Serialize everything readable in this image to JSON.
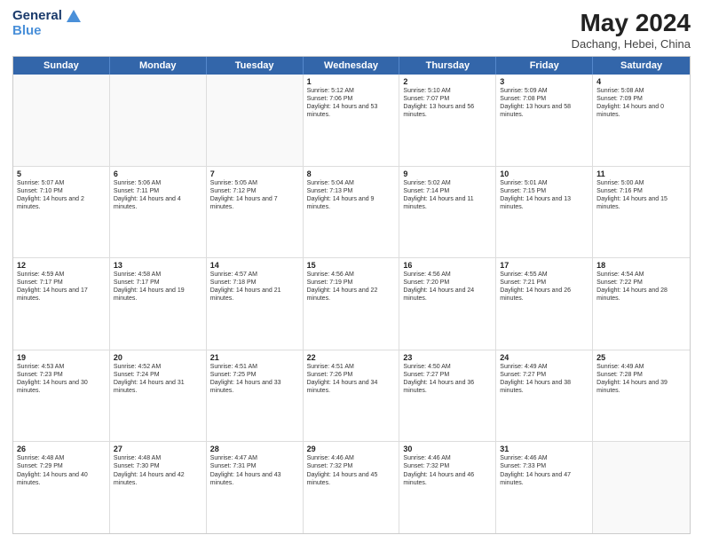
{
  "header": {
    "logo_line1": "General",
    "logo_line2": "Blue",
    "main_title": "May 2024",
    "subtitle": "Dachang, Hebei, China"
  },
  "weekdays": [
    "Sunday",
    "Monday",
    "Tuesday",
    "Wednesday",
    "Thursday",
    "Friday",
    "Saturday"
  ],
  "weeks": [
    [
      {
        "day": "",
        "sunrise": "",
        "sunset": "",
        "daylight": "",
        "empty": true
      },
      {
        "day": "",
        "sunrise": "",
        "sunset": "",
        "daylight": "",
        "empty": true
      },
      {
        "day": "",
        "sunrise": "",
        "sunset": "",
        "daylight": "",
        "empty": true
      },
      {
        "day": "1",
        "sunrise": "Sunrise: 5:12 AM",
        "sunset": "Sunset: 7:06 PM",
        "daylight": "Daylight: 14 hours and 53 minutes."
      },
      {
        "day": "2",
        "sunrise": "Sunrise: 5:10 AM",
        "sunset": "Sunset: 7:07 PM",
        "daylight": "Daylight: 13 hours and 56 minutes."
      },
      {
        "day": "3",
        "sunrise": "Sunrise: 5:09 AM",
        "sunset": "Sunset: 7:08 PM",
        "daylight": "Daylight: 13 hours and 58 minutes."
      },
      {
        "day": "4",
        "sunrise": "Sunrise: 5:08 AM",
        "sunset": "Sunset: 7:09 PM",
        "daylight": "Daylight: 14 hours and 0 minutes."
      }
    ],
    [
      {
        "day": "5",
        "sunrise": "Sunrise: 5:07 AM",
        "sunset": "Sunset: 7:10 PM",
        "daylight": "Daylight: 14 hours and 2 minutes."
      },
      {
        "day": "6",
        "sunrise": "Sunrise: 5:06 AM",
        "sunset": "Sunset: 7:11 PM",
        "daylight": "Daylight: 14 hours and 4 minutes."
      },
      {
        "day": "7",
        "sunrise": "Sunrise: 5:05 AM",
        "sunset": "Sunset: 7:12 PM",
        "daylight": "Daylight: 14 hours and 7 minutes."
      },
      {
        "day": "8",
        "sunrise": "Sunrise: 5:04 AM",
        "sunset": "Sunset: 7:13 PM",
        "daylight": "Daylight: 14 hours and 9 minutes."
      },
      {
        "day": "9",
        "sunrise": "Sunrise: 5:02 AM",
        "sunset": "Sunset: 7:14 PM",
        "daylight": "Daylight: 14 hours and 11 minutes."
      },
      {
        "day": "10",
        "sunrise": "Sunrise: 5:01 AM",
        "sunset": "Sunset: 7:15 PM",
        "daylight": "Daylight: 14 hours and 13 minutes."
      },
      {
        "day": "11",
        "sunrise": "Sunrise: 5:00 AM",
        "sunset": "Sunset: 7:16 PM",
        "daylight": "Daylight: 14 hours and 15 minutes."
      }
    ],
    [
      {
        "day": "12",
        "sunrise": "Sunrise: 4:59 AM",
        "sunset": "Sunset: 7:17 PM",
        "daylight": "Daylight: 14 hours and 17 minutes."
      },
      {
        "day": "13",
        "sunrise": "Sunrise: 4:58 AM",
        "sunset": "Sunset: 7:17 PM",
        "daylight": "Daylight: 14 hours and 19 minutes."
      },
      {
        "day": "14",
        "sunrise": "Sunrise: 4:57 AM",
        "sunset": "Sunset: 7:18 PM",
        "daylight": "Daylight: 14 hours and 21 minutes."
      },
      {
        "day": "15",
        "sunrise": "Sunrise: 4:56 AM",
        "sunset": "Sunset: 7:19 PM",
        "daylight": "Daylight: 14 hours and 22 minutes."
      },
      {
        "day": "16",
        "sunrise": "Sunrise: 4:56 AM",
        "sunset": "Sunset: 7:20 PM",
        "daylight": "Daylight: 14 hours and 24 minutes."
      },
      {
        "day": "17",
        "sunrise": "Sunrise: 4:55 AM",
        "sunset": "Sunset: 7:21 PM",
        "daylight": "Daylight: 14 hours and 26 minutes."
      },
      {
        "day": "18",
        "sunrise": "Sunrise: 4:54 AM",
        "sunset": "Sunset: 7:22 PM",
        "daylight": "Daylight: 14 hours and 28 minutes."
      }
    ],
    [
      {
        "day": "19",
        "sunrise": "Sunrise: 4:53 AM",
        "sunset": "Sunset: 7:23 PM",
        "daylight": "Daylight: 14 hours and 30 minutes."
      },
      {
        "day": "20",
        "sunrise": "Sunrise: 4:52 AM",
        "sunset": "Sunset: 7:24 PM",
        "daylight": "Daylight: 14 hours and 31 minutes."
      },
      {
        "day": "21",
        "sunrise": "Sunrise: 4:51 AM",
        "sunset": "Sunset: 7:25 PM",
        "daylight": "Daylight: 14 hours and 33 minutes."
      },
      {
        "day": "22",
        "sunrise": "Sunrise: 4:51 AM",
        "sunset": "Sunset: 7:26 PM",
        "daylight": "Daylight: 14 hours and 34 minutes."
      },
      {
        "day": "23",
        "sunrise": "Sunrise: 4:50 AM",
        "sunset": "Sunset: 7:27 PM",
        "daylight": "Daylight: 14 hours and 36 minutes."
      },
      {
        "day": "24",
        "sunrise": "Sunrise: 4:49 AM",
        "sunset": "Sunset: 7:27 PM",
        "daylight": "Daylight: 14 hours and 38 minutes."
      },
      {
        "day": "25",
        "sunrise": "Sunrise: 4:49 AM",
        "sunset": "Sunset: 7:28 PM",
        "daylight": "Daylight: 14 hours and 39 minutes."
      }
    ],
    [
      {
        "day": "26",
        "sunrise": "Sunrise: 4:48 AM",
        "sunset": "Sunset: 7:29 PM",
        "daylight": "Daylight: 14 hours and 40 minutes."
      },
      {
        "day": "27",
        "sunrise": "Sunrise: 4:48 AM",
        "sunset": "Sunset: 7:30 PM",
        "daylight": "Daylight: 14 hours and 42 minutes."
      },
      {
        "day": "28",
        "sunrise": "Sunrise: 4:47 AM",
        "sunset": "Sunset: 7:31 PM",
        "daylight": "Daylight: 14 hours and 43 minutes."
      },
      {
        "day": "29",
        "sunrise": "Sunrise: 4:46 AM",
        "sunset": "Sunset: 7:32 PM",
        "daylight": "Daylight: 14 hours and 45 minutes."
      },
      {
        "day": "30",
        "sunrise": "Sunrise: 4:46 AM",
        "sunset": "Sunset: 7:32 PM",
        "daylight": "Daylight: 14 hours and 46 minutes."
      },
      {
        "day": "31",
        "sunrise": "Sunrise: 4:46 AM",
        "sunset": "Sunset: 7:33 PM",
        "daylight": "Daylight: 14 hours and 47 minutes."
      },
      {
        "day": "",
        "sunrise": "",
        "sunset": "",
        "daylight": "",
        "empty": true
      }
    ]
  ]
}
